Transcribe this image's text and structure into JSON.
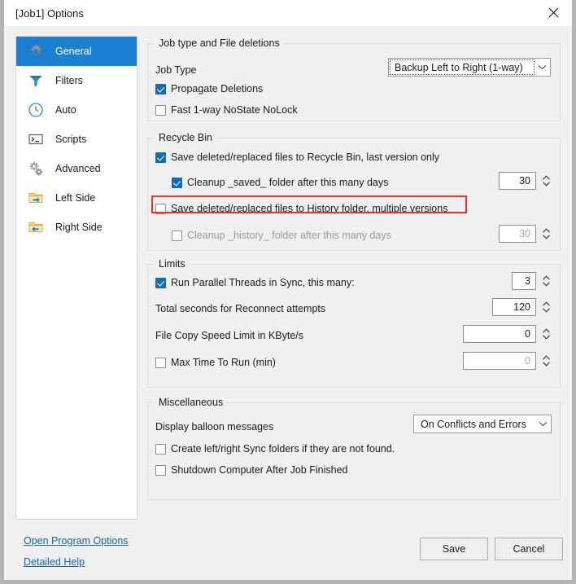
{
  "window": {
    "title": "[Job1] Options",
    "close_icon": "close-icon"
  },
  "sidebar": {
    "items": [
      {
        "label": "General",
        "icon": "gear-icon",
        "selected": true
      },
      {
        "label": "Filters",
        "icon": "funnel-icon",
        "selected": false
      },
      {
        "label": "Auto",
        "icon": "clock-icon",
        "selected": false
      },
      {
        "label": "Scripts",
        "icon": "console-icon",
        "selected": false
      },
      {
        "label": "Advanced",
        "icon": "gears-icon",
        "selected": false
      },
      {
        "label": "Left Side",
        "icon": "folder-right-arrow-icon",
        "selected": false
      },
      {
        "label": "Right Side",
        "icon": "folder-left-arrow-icon",
        "selected": false
      }
    ]
  },
  "groups": {
    "job_type": {
      "legend": "Job type and File deletions",
      "job_type_label": "Job Type",
      "job_type_value": "Backup Left to Right (1-way)",
      "propagate_deletions": {
        "label": "Propagate Deletions",
        "checked": true
      },
      "fast_nostate": {
        "label": "Fast 1-way NoState NoLock",
        "checked": false
      }
    },
    "recycle_bin": {
      "legend": "Recycle Bin",
      "save_recycle": {
        "label": "Save deleted/replaced files to Recycle Bin, last version only",
        "checked": true
      },
      "cleanup_saved": {
        "label": "Cleanup _saved_ folder after this many days",
        "checked": true,
        "value": "30"
      },
      "save_history": {
        "label": "Save deleted/replaced files to History folder, multiple versions",
        "checked": false
      },
      "cleanup_history": {
        "label": "Cleanup _history_ folder after this many days",
        "checked": false,
        "value": "30"
      }
    },
    "limits": {
      "legend": "Limits",
      "parallel_threads": {
        "label": "Run Parallel Threads in Sync, this many:",
        "checked": true,
        "value": "3"
      },
      "reconnect_seconds": {
        "label": "Total seconds for Reconnect attempts",
        "value": "120"
      },
      "copy_speed_limit": {
        "label": "File Copy Speed Limit in KByte/s",
        "value": "0"
      },
      "max_time_to_run": {
        "label": "Max Time To Run (min)",
        "checked": false,
        "value": "0"
      }
    },
    "miscellaneous": {
      "legend": "Miscellaneous",
      "balloon_label": "Display balloon messages",
      "balloon_value": "On Conflicts and Errors",
      "create_folders": {
        "label": "Create left/right Sync folders if they are not found.",
        "checked": false
      },
      "shutdown_computer": {
        "label": "Shutdown Computer After Job Finished",
        "checked": false
      }
    }
  },
  "footer": {
    "open_program_options": "Open Program Options",
    "detailed_help": "Detailed Help",
    "save": "Save",
    "cancel": "Cancel"
  },
  "annotation": {
    "highlight_color": "#ee3124",
    "highlight_target": "save_history_row"
  }
}
